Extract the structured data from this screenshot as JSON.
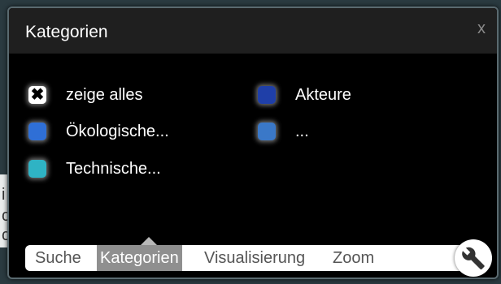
{
  "background": {
    "fragments": [
      "i",
      "c",
      "c"
    ]
  },
  "panel": {
    "title": "Kategorien",
    "close_label": "x"
  },
  "categories": [
    {
      "label": "zeige alles",
      "checked": true,
      "color": "#ffffff"
    },
    {
      "label": "Ökologische...",
      "checked": false,
      "color": "#2f6fd6"
    },
    {
      "label": "Technische...",
      "checked": false,
      "color": "#2fb3c4"
    },
    {
      "label": "Akteure",
      "checked": false,
      "color": "#1f3fa8"
    },
    {
      "label": "...",
      "checked": false,
      "color": "#3a78c8"
    }
  ],
  "tabs": [
    {
      "label": "Suche",
      "active": false
    },
    {
      "label": "Kategorien",
      "active": true
    },
    {
      "label": "Visualisierung",
      "active": false
    },
    {
      "label": "Zoom",
      "active": false
    }
  ],
  "tools_button": {
    "icon": "wrench-icon"
  }
}
